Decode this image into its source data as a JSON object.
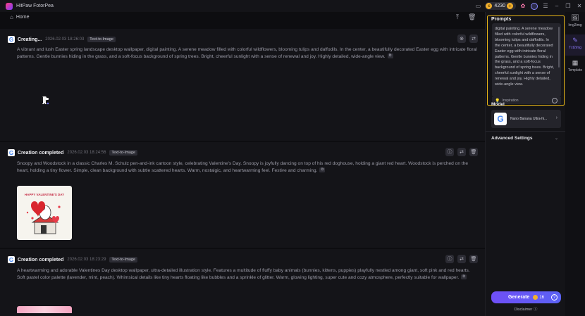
{
  "app": {
    "title": "HitPaw FotorPea",
    "coins": "4230"
  },
  "nav": {
    "home_label": "Home"
  },
  "feed": [
    {
      "status": "Creating...",
      "timestamp": "2026.02.03  18:26:03",
      "tag": "Text-to-Image",
      "prompt": "A vibrant and lush Easter spring landscape desktop wallpaper, digital painting. A serene meadow filled with colorful wildflowers, blooming tulips and daffodils. In the center, a beautifully decorated Easter egg with intricate floral patterns. Gentle bunnies hiding in the grass, and a soft-focus background of spring trees. Bright, cheerful sunlight with a sense of renewal and joy. Highly detailed, wide-angle view."
    },
    {
      "status": "Creation completed",
      "timestamp": "2026.02.03  18:24:56",
      "tag": "Text-to-Image",
      "prompt": "Snoopy and Woodstock in a classic Charles M. Schulz pen-and-ink cartoon style, celebrating Valentine's Day. Snoopy is joyfully dancing on top of his red doghouse, holding a giant red heart. Woodstock is perched on the heart, holding a tiny flower. Simple, clean background with subtle scattered hearts. Warm, nostalgic, and heartwarming feel. Festive and charming.",
      "thumbnail_text": "HAPPY VALENTINE'S DAY"
    },
    {
      "status": "Creation completed",
      "timestamp": "2026.02.03  18:23:29",
      "tag": "Text-to-Image",
      "prompt": "A heartwarming and adorable Valentines Day desktop wallpaper, ultra-detailed illustration style. Features a multitude of fluffy baby animals (bunnies, kittens, puppies) playfully nestled among giant, soft pink and red hearts. Soft pastel color palette (lavender, mint, peach). Whimsical details like tiny hearts floating like bubbles and a sprinkle of glitter. Warm, glowing lighting, super cute and cozy atmosphere, perfectly suitable for wallpaper."
    }
  ],
  "panel": {
    "prompts_title": "Prompts",
    "prompt_text": "digital painting. A serene meadow filled with colorful wildflowers, blooming tulips and daffodils. In the center, a beautifully decorated Easter egg with intricate floral patterns. Gentle bunnies hiding in the grass, and a soft-focus background of spring trees. Bright, cheerful sunlight with a sense of renewal and joy. Highly detailed, wide-angle view.",
    "inspiration_label": "Inspiration",
    "model_title": "Model",
    "model_name": "Nano Banana Ultra-hi...",
    "advanced_label": "Advanced Settings",
    "generate_label": "Generate",
    "generate_cost": "16",
    "disclaimer": "Disclaimer"
  },
  "rail": [
    {
      "label": "Img2img",
      "icon": "image-icon"
    },
    {
      "label": "Txt2img",
      "icon": "text-image-icon",
      "active": true
    },
    {
      "label": "Template",
      "icon": "template-icon"
    }
  ],
  "colors": {
    "accent": "#6f4ff6",
    "highlight_border": "#e6b417",
    "coin": "#f2b02c"
  }
}
